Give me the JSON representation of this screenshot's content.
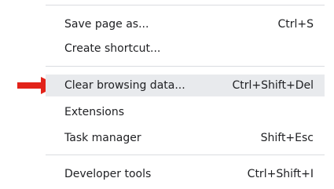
{
  "menu": {
    "items": [
      {
        "label": "Save page as...",
        "shortcut": "Ctrl+S"
      },
      {
        "label": "Create shortcut...",
        "shortcut": ""
      },
      {
        "label": "Clear browsing data...",
        "shortcut": "Ctrl+Shift+Del"
      },
      {
        "label": "Extensions",
        "shortcut": ""
      },
      {
        "label": "Task manager",
        "shortcut": "Shift+Esc"
      },
      {
        "label": "Developer tools",
        "shortcut": "Ctrl+Shift+I"
      }
    ],
    "highlighted_item": "Clear browsing data..."
  },
  "annotation": {
    "arrow_color": "#e2231a",
    "arrow_icon": "red-arrow-right-icon"
  }
}
